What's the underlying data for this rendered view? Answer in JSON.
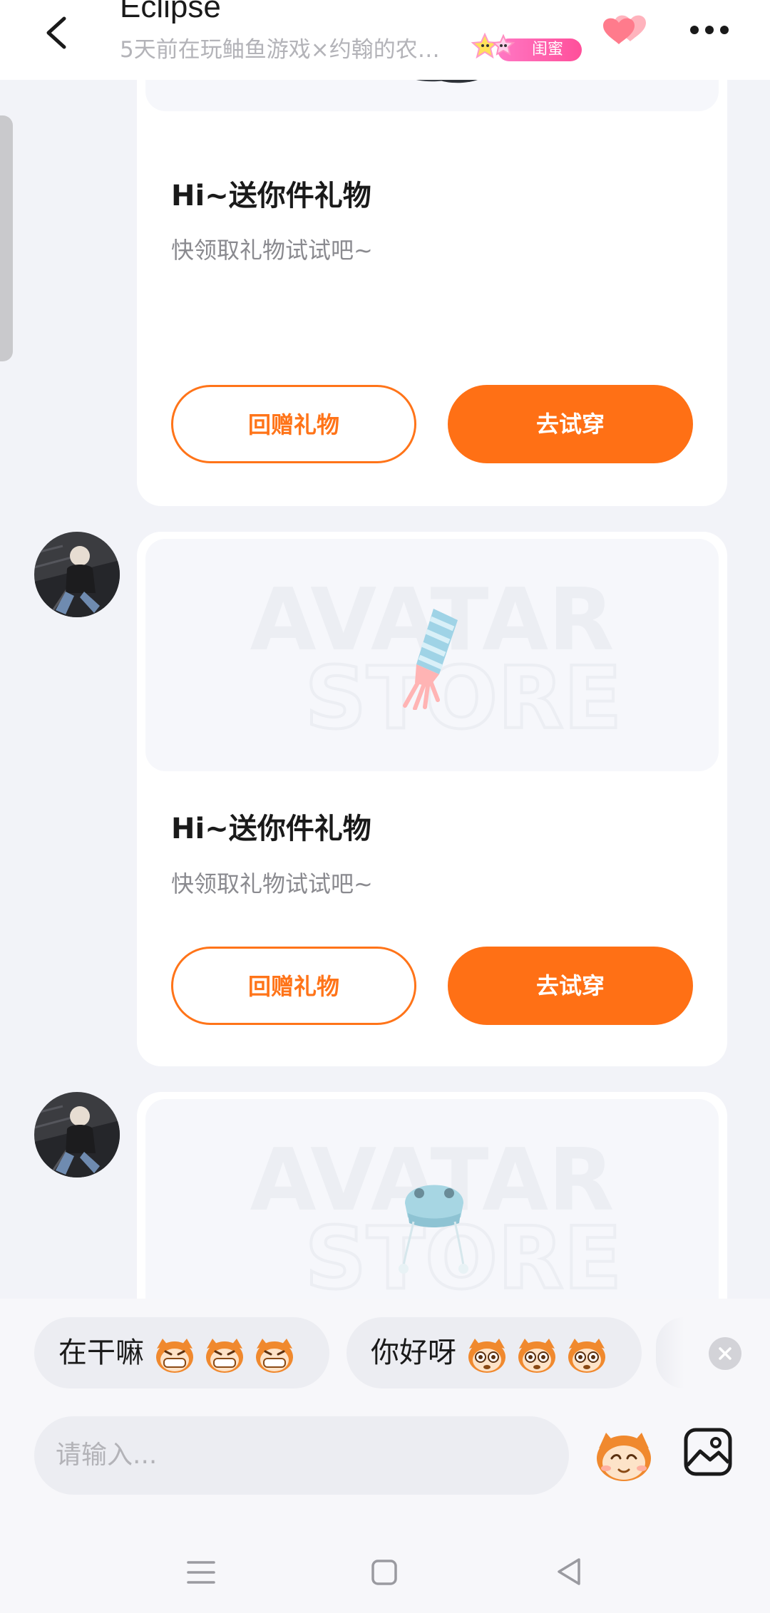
{
  "header": {
    "title": "Eclipse",
    "subtitle": "5天前在玩鲉鱼游戏×约翰的农…",
    "relation_badge": "闺蜜",
    "icons": {
      "back": "chevron-left-icon",
      "hearts": "double-heart-icon",
      "more": "more-dots-icon"
    }
  },
  "messages": [
    {
      "item": "shoes",
      "title": "Hi~送你件礼物",
      "subtitle": "快领取礼物试试吧~",
      "return_gift_label": "回赠礼物",
      "try_on_label": "去试穿"
    },
    {
      "item": "glove",
      "title": "Hi~送你件礼物",
      "subtitle": "快领取礼物试试吧~",
      "return_gift_label": "回赠礼物",
      "try_on_label": "去试穿"
    },
    {
      "item": "hat"
    }
  ],
  "quick_replies": [
    {
      "text": "在干嘛",
      "emoji": "grinning-monkey-emoji"
    },
    {
      "text": "你好呀",
      "emoji": "wide-eyed-monkey-emoji"
    }
  ],
  "input": {
    "placeholder": "请输入..."
  },
  "toolbar": {
    "emoji_icon": "monkey-face-icon",
    "image_icon": "image-icon"
  },
  "colors": {
    "accent": "#ff7015",
    "background": "#f2f3f8",
    "card": "#ffffff",
    "badge_pink": "#ff5aa8"
  }
}
